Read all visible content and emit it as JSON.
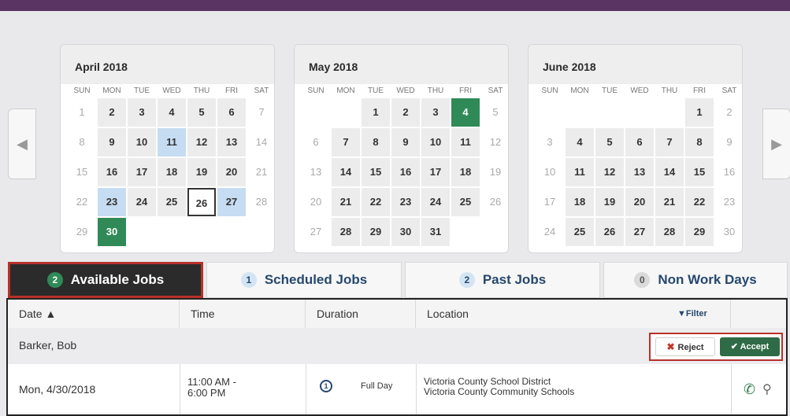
{
  "nav": {
    "prev_icon": "◀",
    "next_icon": "▶"
  },
  "days_of_week": [
    "SUN",
    "MON",
    "TUE",
    "WED",
    "THU",
    "FRI",
    "SAT"
  ],
  "calendars": [
    {
      "title": "April 2018",
      "start": 0,
      "days": 30,
      "blue": [
        11,
        23,
        27
      ],
      "green": [
        30
      ],
      "today": 26
    },
    {
      "title": "May 2018",
      "start": 2,
      "days": 31,
      "blue": [],
      "green": [
        4
      ],
      "today": null
    },
    {
      "title": "June 2018",
      "start": 5,
      "days": 30,
      "blue": [],
      "green": [],
      "today": null
    }
  ],
  "tabs": [
    {
      "count": "2",
      "label": "Available Jobs"
    },
    {
      "count": "1",
      "label": "Scheduled Jobs"
    },
    {
      "count": "2",
      "label": "Past Jobs"
    },
    {
      "count": "0",
      "label": "Non Work Days"
    }
  ],
  "table": {
    "headers": {
      "date": "Date ▲",
      "time": "Time",
      "duration": "Duration",
      "location": "Location"
    },
    "filter_label": "Filter",
    "group": "Barker, Bob",
    "reject_label": "Reject",
    "accept_label": "✔ Accept",
    "row": {
      "date": "Mon, 4/30/2018",
      "time_start": "11:00 AM -",
      "time_end": "6:00 PM",
      "duration_icon": "1",
      "duration": "Full Day",
      "location_line1": "Victoria County School District",
      "location_line2": "Victoria County Community Schools"
    }
  },
  "colors": {
    "green": "#2f8a57",
    "blue": "#c6dcf2",
    "accent_red": "#b9302a",
    "header_purple": "#5a3463"
  }
}
